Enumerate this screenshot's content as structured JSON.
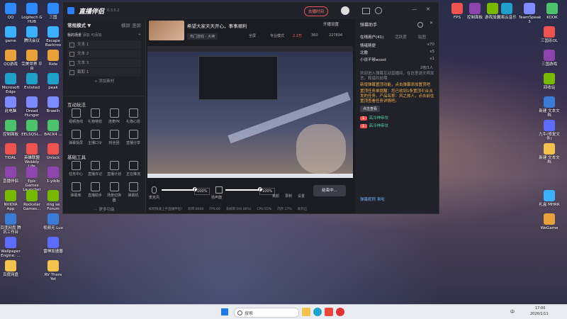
{
  "desktop_left_col1": [
    "QQ",
    "game",
    "QQ游戏",
    "Microsoft Edge",
    "此电脑",
    "控制面板",
    "TIDAL",
    "直播伴侣",
    "NVIDIA App",
    "百度网盘 腾讯工作台",
    "Wallpaper Engine: ...",
    "百度网盘"
  ],
  "desktop_left_col2": [
    "Logitech G HUB",
    "腾讯会议",
    "完美世界 平台",
    "Enlisted",
    "Dread Hunger",
    "EELSQSL...",
    "英雄联盟 Wobbly Life",
    "Epic Games Launcher",
    "Rockstar Games..."
  ],
  "desktop_left_col3": [
    "三国",
    "Escape Backroo",
    "Ride",
    "peak",
    "Brawlh",
    "BACK4 ...",
    "Unlock",
    "1-yiblb",
    "ring se Forum",
    "视频无 Lux",
    "雷神加速器",
    "RV There Yet"
  ],
  "desktop_right_col1": [
    "FPS",
    "控制面板",
    "游戏加速",
    "",
    "",
    "",
    "",
    "",
    "",
    "",
    "",
    ""
  ],
  "desktop_right_items": [
    "网易云音乐",
    "TeamSpeak 3",
    "KOOK",
    "三国杀OL",
    "三国游戏",
    "回收站",
    "新建 文本文档",
    "九牛(修复文件)",
    "新建 文本文档",
    "",
    "礼盒 MHRR",
    "WeGame"
  ],
  "app": {
    "title": "直播伴侣",
    "version": "6.3.5.2",
    "record_btn": "去播时间",
    "status": "开播助手",
    "minimize": "—",
    "close": "✕",
    "mode_label": "常规模式 ▼",
    "mode_links": [
      "横屏",
      "竖屏"
    ],
    "scene_tabs": [
      "我的场景",
      "添加",
      "可添加"
    ],
    "sources": [
      "文本 1",
      "文本 2",
      "文本 3",
      "截取 1"
    ],
    "add_material": "+ 添加素材",
    "interactive_title": "互动玩法",
    "interactive_items": [
      "视频连线",
      "礼物特效",
      "连麦PK",
      "礼物心愿",
      "弹幕投屏",
      "主播口令",
      "粉丝团",
      "直播分享"
    ],
    "basic_tools_title": "基础工具",
    "basic_tools": [
      "任务中心",
      "直播日记",
      "直播计划",
      "正在推流",
      "弹幕库",
      "直播助手",
      "场景切换器",
      "弹幕机"
    ],
    "more_features": "··· 更多功能",
    "stream_title": "希望大家天天开心，事事顺利",
    "stream_tag": "热门游戏 - 大神",
    "stream_open": "开播设置",
    "stream_buttons": [
      "全屏",
      "专业模式"
    ],
    "stream_counts": [
      "2.2万",
      "360",
      "227894"
    ],
    "mic_label": "麦克风",
    "mic_pct": "100%",
    "speaker_label": "扬声器",
    "speaker_pct": "100%",
    "bottom_tools": [
      "美颜",
      "录制",
      "设置"
    ],
    "live_btn": "结束中...",
    "status_bar": [
      "如何快速上手直播伴侣?",
      "码率:8000",
      "FPS:60",
      "丢帧率:0(0.00%)",
      "CPU:55%",
      "内存:17%",
      "未开启"
    ]
  },
  "danmu": {
    "title": "弹幕助手",
    "tabs": [
      "在线用户(41)",
      "活跃度",
      "贴图"
    ],
    "top_users": [
      {
        "name": "情绪随便",
        "tag": "x70"
      },
      {
        "name": "北撒",
        "tag": "x5"
      },
      {
        "name": "小说不够wood",
        "tag": "x1"
      }
    ],
    "count_label": "2倍/1人",
    "notice": "欢迎进入弹幕互动直播间，在这里请文明发言，和谐共处哦",
    "tip": "新增弹幕置顶功能，点击弹幕添加置顶吧",
    "task_notice": "置顶任务单提醒：您已收到1条置顶平台派发的任务，产品名称：风之旅人，点击前往置顶查看任务详情吧。",
    "task_btn": "点击查看",
    "msgs": [
      {
        "lv": "1",
        "text": "高冷神帝坟"
      },
      {
        "lv": "1",
        "text": "高冷神帝坟"
      }
    ],
    "footer_user": "弹幕昵称 来啦"
  },
  "taskbar": {
    "search_placeholder": "搜索",
    "time": "17:00",
    "date": "2026/1/11",
    "lang": "中"
  }
}
